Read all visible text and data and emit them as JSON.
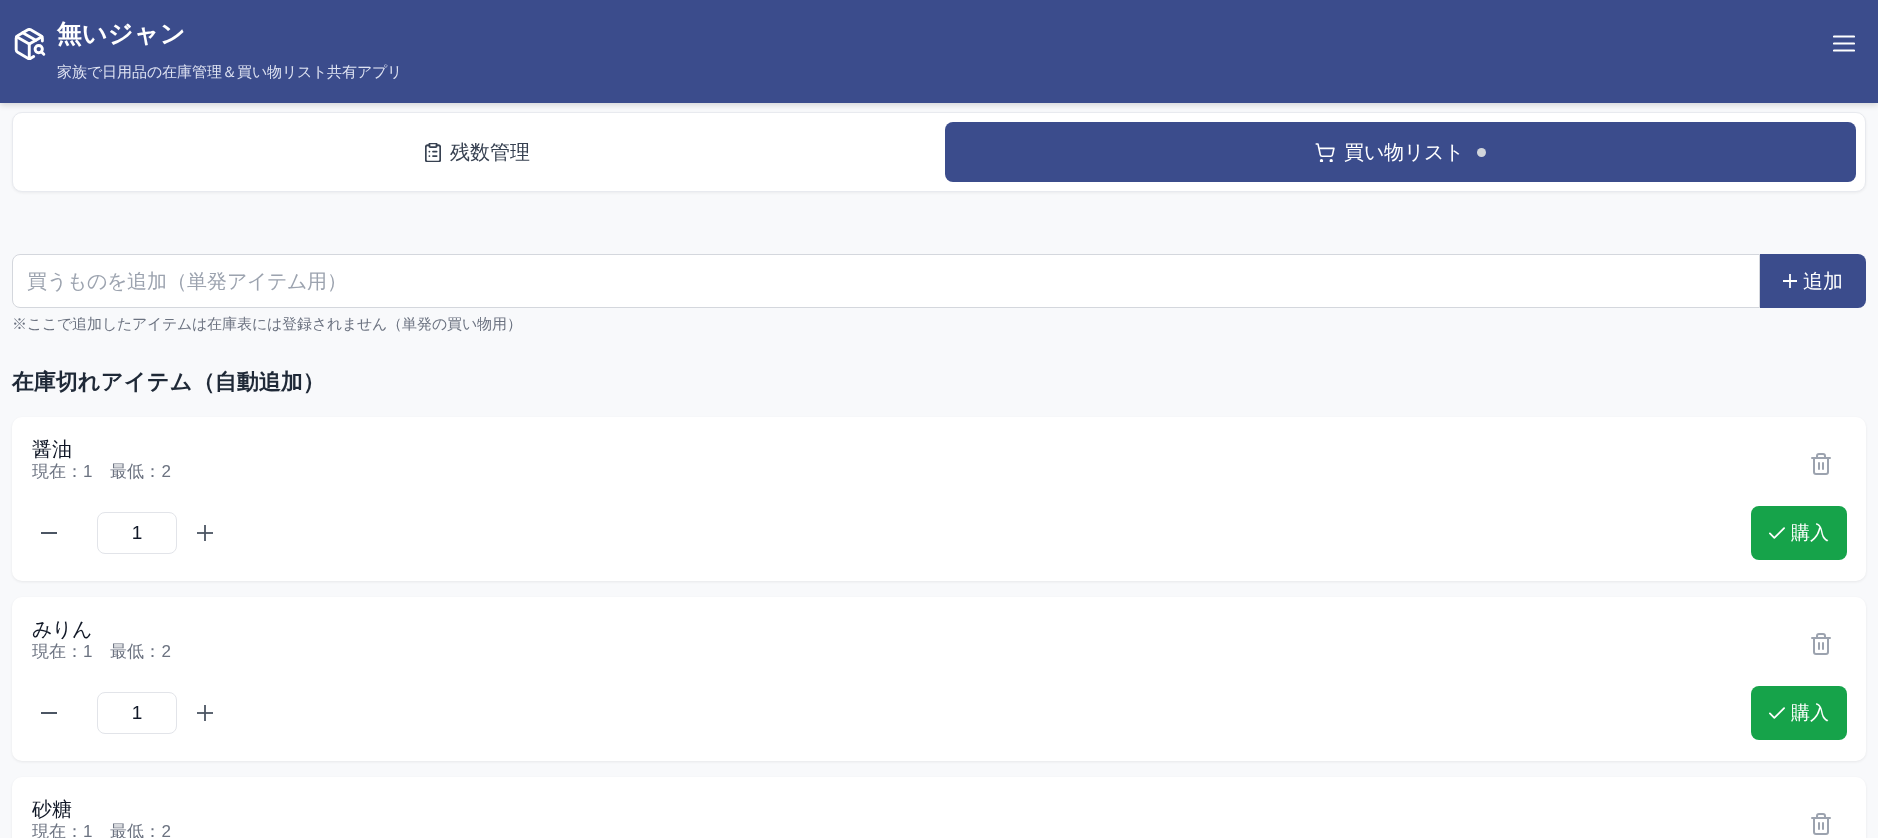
{
  "header": {
    "title": "無いジャン",
    "subtitle": "家族で日用品の在庫管理＆買い物リスト共有アプリ"
  },
  "tabs": [
    {
      "label": "残数管理",
      "selected": false,
      "dot": false
    },
    {
      "label": "買い物リスト",
      "selected": true,
      "dot": true
    }
  ],
  "add_form": {
    "placeholder": "買うものを追加（単発アイテム用）",
    "button": "追加",
    "note": "※ここで追加したアイテムは在庫表には登録されません（単発の買い物用）"
  },
  "section": {
    "title": "在庫切れアイテム（自動追加）",
    "items": [
      {
        "name": "醤油",
        "current": "現在：1",
        "minimum": "最低：2",
        "quantity": "1",
        "buy_label": "購入"
      },
      {
        "name": "みりん",
        "current": "現在：1",
        "minimum": "最低：2",
        "quantity": "1",
        "buy_label": "購入"
      },
      {
        "name": "砂糖",
        "current": "現在：1",
        "minimum": "最低：2"
      }
    ]
  }
}
